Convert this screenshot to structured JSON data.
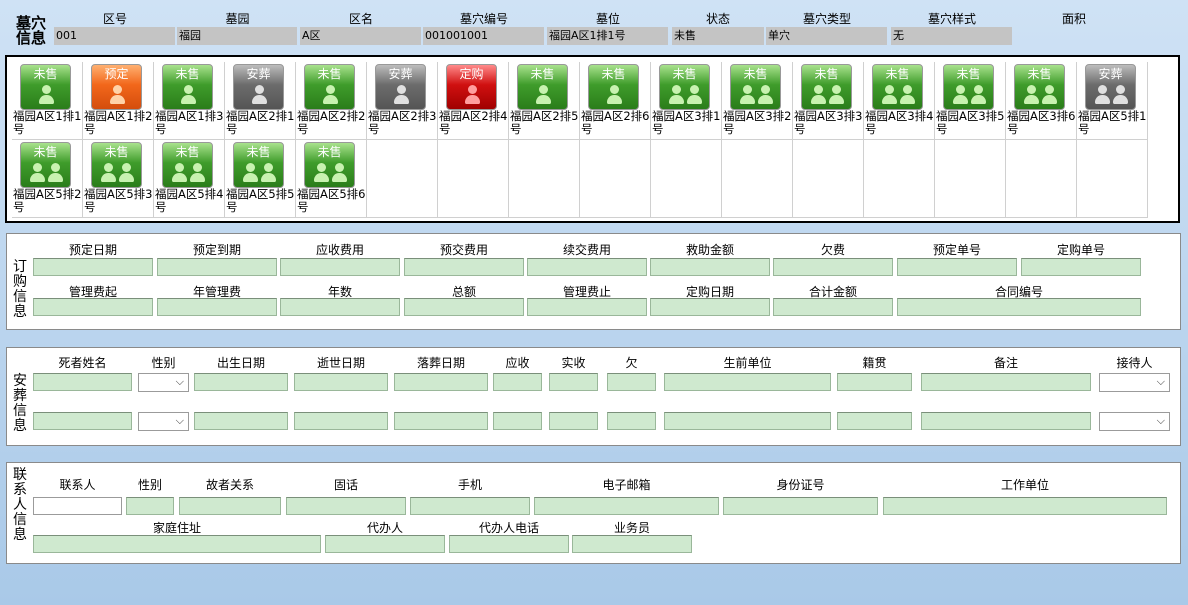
{
  "top": {
    "title": "墓穴信息",
    "labels": [
      "区号",
      "墓园",
      "区名",
      "墓穴编号",
      "墓位",
      "状态",
      "墓穴类型",
      "墓穴样式",
      "面积"
    ],
    "values": [
      "001",
      "福园",
      "A区",
      "001001001",
      "福园A区1排1号",
      "未售",
      "单穴",
      "无",
      ""
    ]
  },
  "graves": [
    {
      "status": "未售",
      "color": "green",
      "people": 1,
      "name": "福园A区1排1号"
    },
    {
      "status": "预定",
      "color": "orange",
      "people": 1,
      "name": "福园A区1排2号"
    },
    {
      "status": "未售",
      "color": "green",
      "people": 1,
      "name": "福园A区1排3号"
    },
    {
      "status": "安葬",
      "color": "gray",
      "people": 1,
      "name": "福园A区2排1号"
    },
    {
      "status": "未售",
      "color": "green",
      "people": 1,
      "name": "福园A区2排2号"
    },
    {
      "status": "安葬",
      "color": "gray",
      "people": 1,
      "name": "福园A区2排3号"
    },
    {
      "status": "定购",
      "color": "red",
      "people": 1,
      "name": "福园A区2排4号"
    },
    {
      "status": "未售",
      "color": "green",
      "people": 1,
      "name": "福园A区2排5号"
    },
    {
      "status": "未售",
      "color": "green",
      "people": 1,
      "name": "福园A区2排6号"
    },
    {
      "status": "未售",
      "color": "green",
      "people": 2,
      "name": "福园A区3排1号"
    },
    {
      "status": "未售",
      "color": "green",
      "people": 2,
      "name": "福园A区3排2号"
    },
    {
      "status": "未售",
      "color": "green",
      "people": 2,
      "name": "福园A区3排3号"
    },
    {
      "status": "未售",
      "color": "green",
      "people": 2,
      "name": "福园A区3排4号"
    },
    {
      "status": "未售",
      "color": "green",
      "people": 2,
      "name": "福园A区3排5号"
    },
    {
      "status": "未售",
      "color": "green",
      "people": 2,
      "name": "福园A区3排6号"
    },
    {
      "status": "安葬",
      "color": "gray",
      "people": 2,
      "name": "福园A区5排1号"
    },
    {
      "status": "未售",
      "color": "green",
      "people": 2,
      "name": "福园A区5排2号"
    },
    {
      "status": "未售",
      "color": "green",
      "people": 2,
      "name": "福园A区5排3号"
    },
    {
      "status": "未售",
      "color": "green",
      "people": 2,
      "name": "福园A区5排4号"
    },
    {
      "status": "未售",
      "color": "green",
      "people": 2,
      "name": "福园A区5排5号"
    },
    {
      "status": "未售",
      "color": "green",
      "people": 2,
      "name": "福园A区5排6号"
    }
  ],
  "order": {
    "title": "订购信息",
    "row1": [
      "预定日期",
      "预定到期",
      "应收费用",
      "预交费用",
      "续交费用",
      "救助金额",
      "欠费",
      "预定单号",
      "定购单号"
    ],
    "row2": [
      "管理费起",
      "年管理费",
      "年数",
      "总额",
      "管理费止",
      "定购日期",
      "合计金额",
      "合同编号"
    ]
  },
  "burial": {
    "title": "安葬信息",
    "labels": [
      "死者姓名",
      "性别",
      "出生日期",
      "逝世日期",
      "落葬日期",
      "应收",
      "实收",
      "欠",
      "生前单位",
      "籍贯",
      "备注",
      "接待人"
    ]
  },
  "contact": {
    "title": "联系人信息",
    "row1": [
      "联系人",
      "性别",
      "故者关系",
      "固话",
      "手机",
      "电子邮箱",
      "身份证号",
      "工作单位"
    ],
    "row2": [
      "家庭住址",
      "代办人",
      "代办人电话",
      "业务员"
    ]
  },
  "colors": {
    "field_green": "#cfe9cf",
    "field_gray": "#c4c4c4",
    "tile_green": "#3f9c2b",
    "tile_orange": "#f2671b",
    "tile_gray": "#6c6c6c",
    "tile_red": "#d01010"
  }
}
